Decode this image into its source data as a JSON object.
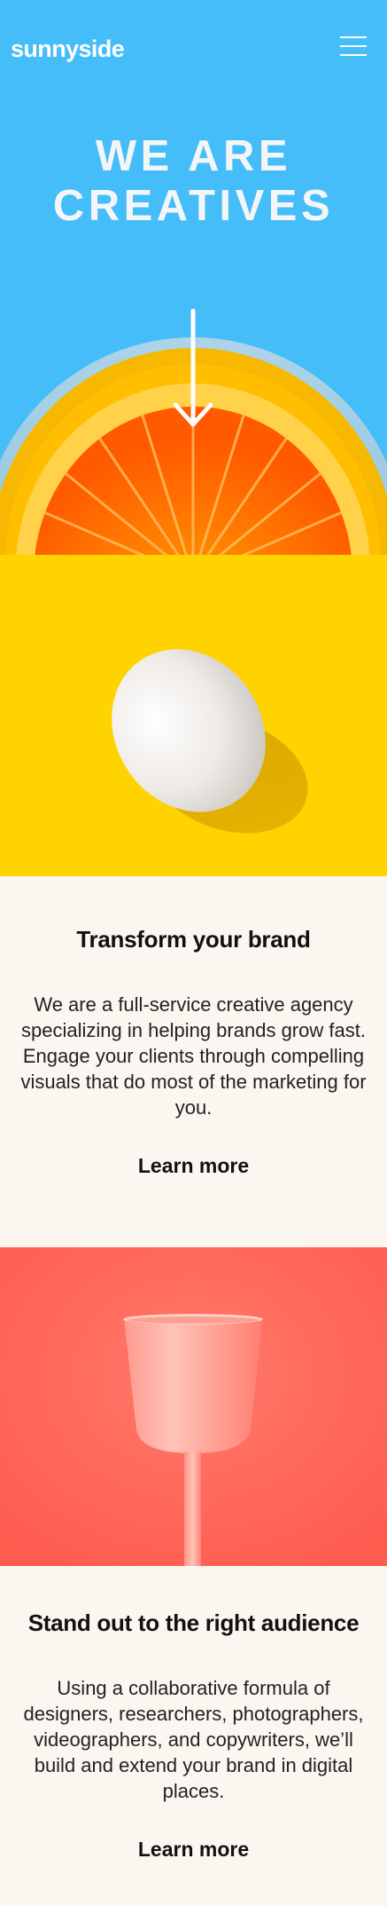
{
  "header": {
    "logo": "sunnyside",
    "menu_icon": "hamburger-menu-icon"
  },
  "hero": {
    "title_line1": "WE ARE",
    "title_line2": "CREATIVES",
    "arrow_icon": "arrow-down-icon"
  },
  "sections": [
    {
      "heading": "Transform your brand",
      "body": "We are a full-service creative agency specializing in helping brands grow fast. Engage your clients through compelling visuals that do most of the marketing for you.",
      "link": "Learn more"
    },
    {
      "heading": "Stand out to the right audience",
      "body": "Using a collaborative formula of designers, researchers, photographers, videographers, and copywriters, we’ll build and extend your brand in digital places.",
      "link": "Learn more"
    }
  ],
  "colors": {
    "hero_blue": "#44bdf9",
    "egg_yellow": "#ffd300",
    "glass_coral": "#ff6b5e",
    "cream": "#fbf6f0"
  }
}
